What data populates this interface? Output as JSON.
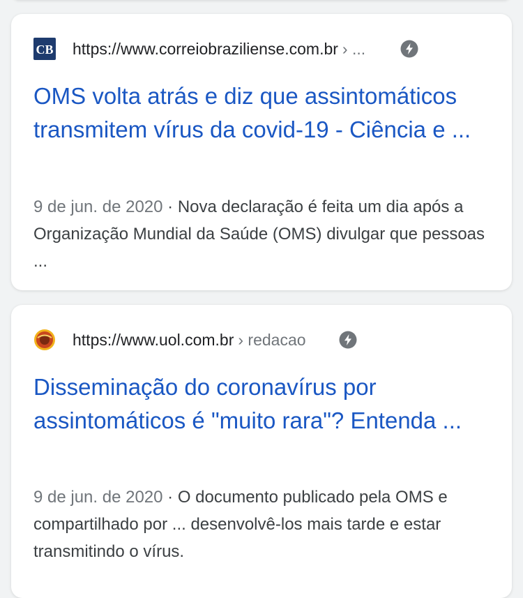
{
  "results": [
    {
      "url": "https://www.correiobraziliense.com.br",
      "breadcrumb": "› ...",
      "favicon_icon": "correio-braziliense-logo-icon",
      "favicon_text": "CB",
      "title": "OMS volta atrás e diz que assintomáticos transmitem vírus da covid-19 - Ciência e ...",
      "date": "9 de jun. de 2020",
      "separator": " · ",
      "snippet": "Nova declaração é feita um dia após a Organização Mundial da Saúde (OMS) divulgar que pessoas ..."
    },
    {
      "url": "https://www.uol.com.br",
      "breadcrumb": "› redacao",
      "favicon_icon": "uol-logo-icon",
      "title": "Disseminação do coronavírus por assintomáticos é \"muito rara\"? Entenda ...",
      "date": "9 de jun. de 2020",
      "separator": " · ",
      "snippet": "O documento publicado pela OMS e compartilhado por ... desenvolvê-los mais tarde e estar transmitindo o vírus."
    }
  ],
  "icons": {
    "amp": "amp-lightning-icon"
  },
  "colors": {
    "link": "#1a57c3",
    "meta": "#70757a",
    "text": "#3c4043",
    "background": "#f1f3f4"
  }
}
